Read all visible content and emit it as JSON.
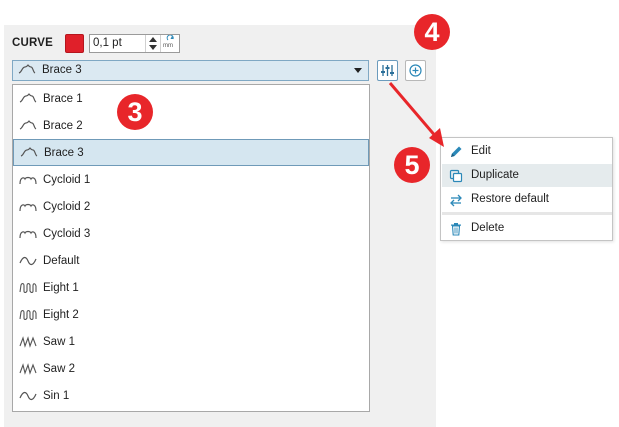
{
  "toolbar": {
    "curve_label": "CURVE",
    "color": "#e0202a",
    "stroke_value": "0,1 pt",
    "unit_label": "mm"
  },
  "combo": {
    "selected": "Brace 3",
    "icon": "brace-curve-icon"
  },
  "buttons": {
    "settings_icon": "sliders-icon",
    "add_icon": "plus-circle-icon"
  },
  "dropdown": {
    "items": [
      {
        "label": "Brace 1",
        "icon": "brace-curve-icon"
      },
      {
        "label": "Brace 2",
        "icon": "brace-curve-icon"
      },
      {
        "label": "Brace 3",
        "icon": "brace-curve-icon",
        "selected": true
      },
      {
        "label": "Cycloid 1",
        "icon": "cycloid-curve-icon"
      },
      {
        "label": "Cycloid 2",
        "icon": "cycloid-curve-icon"
      },
      {
        "label": "Cycloid 3",
        "icon": "cycloid-curve-icon"
      },
      {
        "label": "Default",
        "icon": "wave-curve-icon"
      },
      {
        "label": "Eight 1",
        "icon": "eight-curve-icon"
      },
      {
        "label": "Eight 2",
        "icon": "eight-curve-icon"
      },
      {
        "label": "Saw 1",
        "icon": "saw-curve-icon"
      },
      {
        "label": "Saw 2",
        "icon": "saw-curve-icon"
      },
      {
        "label": "Sin 1",
        "icon": "sine-curve-icon"
      }
    ]
  },
  "menu": {
    "items": [
      {
        "label": "Edit",
        "icon": "pencil-icon"
      },
      {
        "label": "Duplicate",
        "icon": "duplicate-icon",
        "hover": true
      },
      {
        "label": "Restore default",
        "icon": "restore-icon"
      },
      {
        "label": "Delete",
        "icon": "trash-icon"
      }
    ]
  },
  "markers": {
    "m3": "3",
    "m4": "4",
    "m5": "5"
  },
  "colors": {
    "accent": "#2b88b8",
    "marker": "#e8262a",
    "selection": "#d5e6f0"
  }
}
